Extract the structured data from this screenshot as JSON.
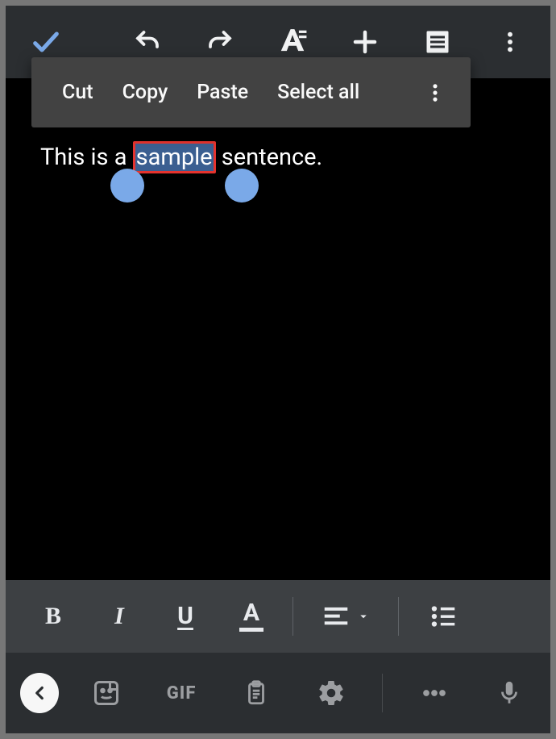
{
  "context_menu": {
    "cut": "Cut",
    "copy": "Copy",
    "paste": "Paste",
    "select_all": "Select all"
  },
  "document": {
    "before": "This is a ",
    "selected": "sample",
    "after": " sentence."
  },
  "format_toolbar": {
    "bold": "B",
    "italic": "I",
    "underline": "U",
    "textcolor": "A"
  },
  "keyboard_bar": {
    "gif": "GIF"
  }
}
